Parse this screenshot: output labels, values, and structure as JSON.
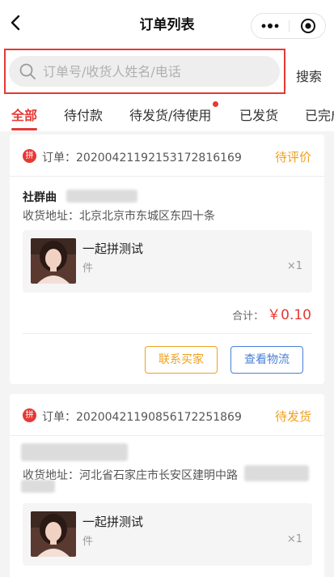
{
  "nav": {
    "title": "订单列表"
  },
  "search": {
    "placeholder": "订单号/收货人姓名/电话",
    "button_label": "搜索"
  },
  "tabs": [
    {
      "label": "全部"
    },
    {
      "label": "待付款"
    },
    {
      "label": "待发货/待使用"
    },
    {
      "label": "已发货"
    },
    {
      "label": "已完成"
    }
  ],
  "orders": [
    {
      "badge": "拼",
      "order_no": "订单：20200421192153172816169",
      "status": "待评价",
      "buyer": "社群曲",
      "address": "收货地址：北京北京市东城区东四十条",
      "product": {
        "name": "一起拼测试",
        "unit": "件",
        "qty": "×1"
      },
      "total_label": "合计：",
      "total_amount": "￥0.10",
      "actions": {
        "contact": "联系买家",
        "logistics": "查看物流"
      }
    },
    {
      "badge": "拼",
      "order_no": "订单：20200421190856172251869",
      "status": "待发货",
      "address": "收货地址：河北省石家庄市长安区建明中路",
      "product": {
        "name": "一起拼测试",
        "unit": "件",
        "qty": "×1"
      }
    }
  ],
  "colors": {
    "accent": "#e53935",
    "status": "#f0a020",
    "link": "#4a7fd8"
  }
}
